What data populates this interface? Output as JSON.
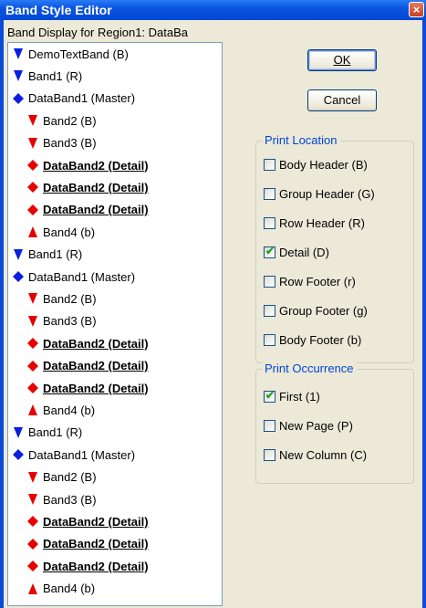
{
  "window": {
    "title": "Band Style Editor",
    "close_glyph": "×"
  },
  "region_label": "Band Display for Region1: DataBa",
  "tree_items": [
    {
      "label": "DemoTextBand (B)",
      "icon": "blue-down-triangle",
      "detail": false
    },
    {
      "label": "Band1 (R)",
      "icon": "blue-down-triangle",
      "detail": false
    },
    {
      "label": "DataBand1 (Master)",
      "icon": "blue-diamond",
      "detail": false
    },
    {
      "label": "Band2 (B)",
      "icon": "red-down-triangle",
      "detail": false
    },
    {
      "label": "Band3 (B)",
      "icon": "red-down-triangle",
      "detail": false
    },
    {
      "label": "DataBand2 (Detail)",
      "icon": "red-diamond",
      "detail": true
    },
    {
      "label": "DataBand2 (Detail)",
      "icon": "red-diamond",
      "detail": true
    },
    {
      "label": "DataBand2 (Detail)",
      "icon": "red-diamond",
      "detail": true
    },
    {
      "label": "Band4 (b)",
      "icon": "red-up-triangle",
      "detail": false
    },
    {
      "label": "Band1 (R)",
      "icon": "blue-down-triangle",
      "detail": false
    },
    {
      "label": "DataBand1 (Master)",
      "icon": "blue-diamond",
      "detail": false
    },
    {
      "label": "Band2 (B)",
      "icon": "red-down-triangle",
      "detail": false
    },
    {
      "label": "Band3 (B)",
      "icon": "red-down-triangle",
      "detail": false
    },
    {
      "label": "DataBand2 (Detail)",
      "icon": "red-diamond",
      "detail": true
    },
    {
      "label": "DataBand2 (Detail)",
      "icon": "red-diamond",
      "detail": true
    },
    {
      "label": "DataBand2 (Detail)",
      "icon": "red-diamond",
      "detail": true
    },
    {
      "label": "Band4 (b)",
      "icon": "red-up-triangle",
      "detail": false
    },
    {
      "label": "Band1 (R)",
      "icon": "blue-down-triangle",
      "detail": false
    },
    {
      "label": "DataBand1 (Master)",
      "icon": "blue-diamond",
      "detail": false
    },
    {
      "label": "Band2 (B)",
      "icon": "red-down-triangle",
      "detail": false
    },
    {
      "label": "Band3 (B)",
      "icon": "red-down-triangle",
      "detail": false
    },
    {
      "label": "DataBand2 (Detail)",
      "icon": "red-diamond",
      "detail": true
    },
    {
      "label": "DataBand2 (Detail)",
      "icon": "red-diamond",
      "detail": true
    },
    {
      "label": "DataBand2 (Detail)",
      "icon": "red-diamond",
      "detail": true
    },
    {
      "label": "Band4 (b)",
      "icon": "red-up-triangle",
      "detail": false
    }
  ],
  "buttons": {
    "ok": "OK",
    "cancel": "Cancel"
  },
  "print_location": {
    "title": "Print Location",
    "options": [
      {
        "label": "Body Header (B)",
        "checked": false
      },
      {
        "label": "Group Header (G)",
        "checked": false
      },
      {
        "label": "Row Header (R)",
        "checked": false
      },
      {
        "label": "Detail (D)",
        "checked": true
      },
      {
        "label": "Row Footer (r)",
        "checked": false
      },
      {
        "label": "Group Footer (g)",
        "checked": false
      },
      {
        "label": "Body Footer (b)",
        "checked": false
      }
    ]
  },
  "print_occurrence": {
    "title": "Print Occurrence",
    "options": [
      {
        "label": "First (1)",
        "checked": true
      },
      {
        "label": "New Page (P)",
        "checked": false
      },
      {
        "label": "New Column (C)",
        "checked": false
      }
    ]
  },
  "colors": {
    "blue": "#0a1ee0",
    "red": "#e80000",
    "group_title": "#0046d5",
    "check": "#21a121"
  }
}
